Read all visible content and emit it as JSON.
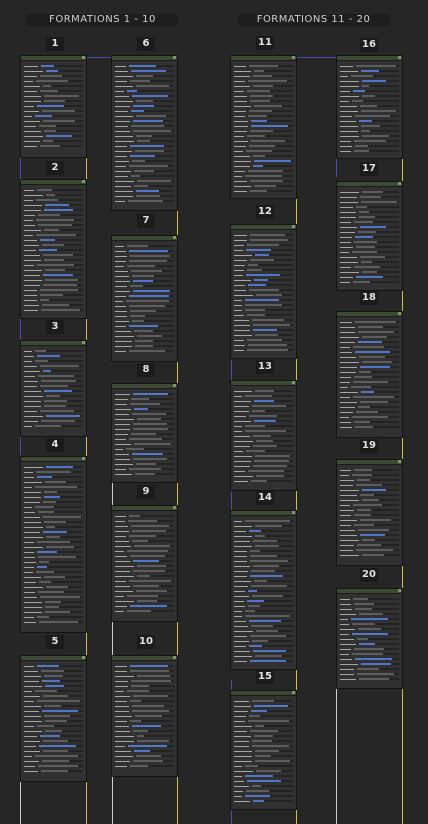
{
  "groups": [
    {
      "title": "FORMATIONS 1 - 10"
    },
    {
      "title": "FORMATIONS 11 - 20"
    }
  ],
  "nodes": [
    {
      "label": "1"
    },
    {
      "label": "2"
    },
    {
      "label": "3"
    },
    {
      "label": "4"
    },
    {
      "label": "5"
    },
    {
      "label": "6"
    },
    {
      "label": "7"
    },
    {
      "label": "8"
    },
    {
      "label": "9"
    },
    {
      "label": "10"
    },
    {
      "label": "11"
    },
    {
      "label": "12"
    },
    {
      "label": "13"
    },
    {
      "label": "14"
    },
    {
      "label": "15"
    },
    {
      "label": "16"
    },
    {
      "label": "17"
    },
    {
      "label": "18"
    },
    {
      "label": "19"
    },
    {
      "label": "20"
    }
  ],
  "colors": {
    "background": "#262626",
    "node_panel": "#313131",
    "node_header": "#3d4a33",
    "wire_blue": "#4a4aa6",
    "wire_yellow": "#c9c43a",
    "wire_white": "#cfcfcf",
    "slider_blue": "#4f76c7"
  }
}
